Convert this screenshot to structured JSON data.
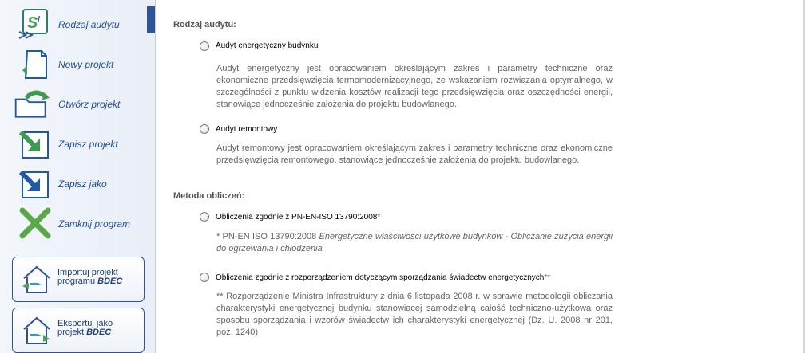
{
  "sidebar": {
    "items": [
      {
        "label": "Rodzaj audytu",
        "icon": "audit-type-icon"
      },
      {
        "label": "Nowy projekt",
        "icon": "new-document-icon"
      },
      {
        "label": "Otwórz projekt",
        "icon": "open-folder-icon"
      },
      {
        "label": "Zapisz projekt",
        "icon": "save-arrow-icon"
      },
      {
        "label": "Zapisz jako",
        "icon": "save-as-icon"
      },
      {
        "label": "Zamknij program",
        "icon": "close-x-icon"
      }
    ],
    "import_button": {
      "line1": "Importuj projekt",
      "line2_prefix": "programu ",
      "line2_bold": "BDEC",
      "icon": "import-house-icon"
    },
    "export_button": {
      "line1": "Eksportuj jako",
      "line2_prefix": "projekt ",
      "line2_bold": "BDEC",
      "icon": "export-house-icon"
    }
  },
  "main": {
    "audit_section_title": "Rodzaj audytu:",
    "audit_options": [
      {
        "label": "Audyt energetyczny budynku",
        "description": "Audyt energetyczny jest opracowaniem określającym zakres i parametry techniczne oraz ekonomiczne przedsięwzięcia termomodernizacyjnego, ze wskazaniem rozwiązania optymalnego, w szczególności z punktu widzenia kosztów realizacji tego przedsięwzięcia oraz oszczędności energii, stanowiące jednocześnie założenia do projektu budowlanego."
      },
      {
        "label": "Audyt remontowy",
        "description": "Audyt remontowy jest opracowaniem określającym zakres i parametry techniczne oraz ekonomiczne przedsięwzięcia remontowego, stanowiące jednocześnie założenia do projektu budowlanego."
      }
    ],
    "method_section_title": "Metoda obliczeń:",
    "method_options": [
      {
        "label": "Obliczenia zgodnie z PN-EN-ISO 13790:2008",
        "marker": "*",
        "note_prefix": "* PN-EN ISO 13790:2008 ",
        "note_italic": "Energetyczne właściwości użytkowe budynków - Obliczanie zużycia energii do ogrzewania i chłodzenia"
      },
      {
        "label": "Obliczenia zgodnie z rozporządzeniem dotyczącym sporządzania świadectw energetycznych",
        "marker": "**",
        "note": "** Rozporządzenie Ministra Infrastruktury z dnia 6 listopada 2008 r. w sprawie metodologii obliczania charakterystyki energetycznej budynku stanowiącej samodzielną całość techniczno-użytkowa oraz sposobu sporządzania i wzorów świadectw ich charakterystyki energetycznej (Dz. U. 2008 nr 201, poz. 1240)"
      }
    ]
  }
}
